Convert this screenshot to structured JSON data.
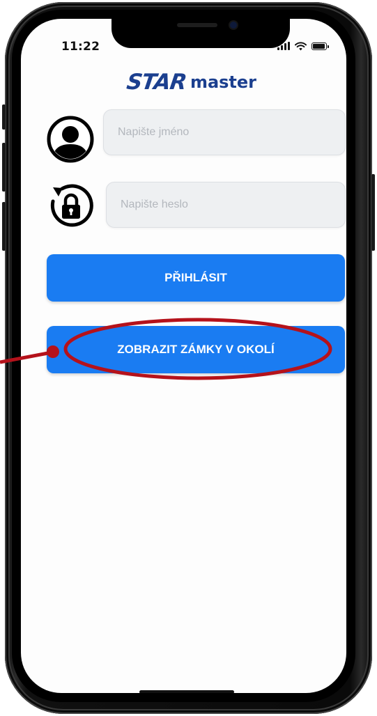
{
  "status_bar": {
    "time": "11:22"
  },
  "logo": {
    "star": "STAR",
    "master": "master"
  },
  "form": {
    "username_placeholder": "Napište jméno",
    "password_placeholder": "Napište heslo"
  },
  "buttons": {
    "login_label": "PŘIHLÁSIT",
    "show_locks_label": "ZOBRAZIT ZÁMKY V OKOLÍ"
  },
  "colors": {
    "primary_button": "#1a7cf2",
    "logo": "#1b3f8f",
    "annotation": "#b5121b"
  },
  "icons": {
    "user": "user-avatar-icon",
    "password": "lock-refresh-icon",
    "signal": "cellular-signal-icon",
    "wifi": "wifi-icon",
    "battery": "battery-icon"
  }
}
